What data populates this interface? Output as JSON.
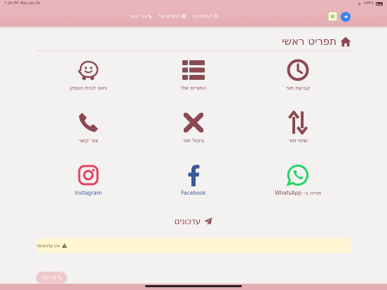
{
  "status_bar": {
    "time": "7:29 PM",
    "date": "Mon Jan 29",
    "battery": "100%"
  },
  "topnav": {
    "items": [
      {
        "label": "קביעת תור",
        "icon": "clock-icon"
      },
      {
        "label": "התורים שלי",
        "icon": "list-icon"
      },
      {
        "label": "צור קשר",
        "icon": "phone-icon"
      }
    ]
  },
  "header": {
    "title": "תפריט ראשי",
    "icon": "home-icon"
  },
  "tiles": [
    {
      "label": "קביעת תור",
      "icon": "clock-icon"
    },
    {
      "label": "התורים שלי",
      "icon": "list-icon"
    },
    {
      "label": "ניווט לבית העסק",
      "icon": "waze-icon"
    },
    {
      "label": "שינוי תור",
      "icon": "swap-arrows-icon"
    },
    {
      "label": "ביטול תור",
      "icon": "x-icon"
    },
    {
      "label": "צור קשר",
      "icon": "phone-icon"
    },
    {
      "label": "פנייה ב- WhatsApp",
      "icon": "whatsapp-icon"
    },
    {
      "label": "Facebook",
      "icon": "facebook-icon"
    },
    {
      "label": "Instagram",
      "icon": "instagram-icon"
    }
  ],
  "updates": {
    "label": "עדכונים",
    "icon": "paper-plane-icon"
  },
  "alert": {
    "text": "אין עדכונים!",
    "icon": "warning-icon"
  },
  "float_button": {
    "label": "צור קשר",
    "icon": "phone-icon"
  },
  "colors": {
    "accent": "#8b4a52",
    "topbar": "#e9b6bb",
    "alert_bg": "#fff7d4",
    "whatsapp": "#25d366",
    "facebook": "#3b5998",
    "instagram": "#e4405f"
  }
}
